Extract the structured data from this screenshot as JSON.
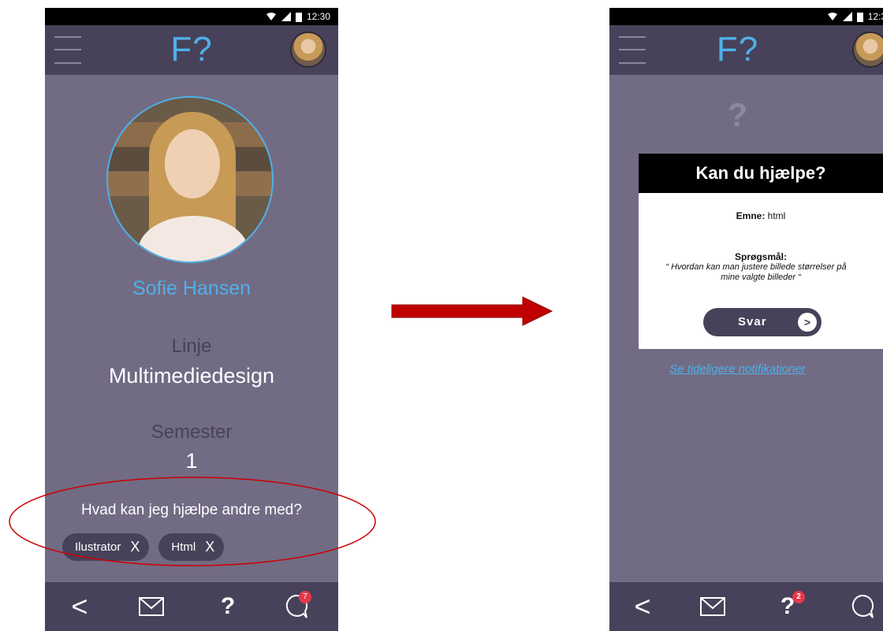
{
  "left_screen": {
    "status_time": "12:30",
    "logo": "F?",
    "profile": {
      "name": "Sofie Hansen",
      "line_label": "Linje",
      "line_value": "Multimediedesign",
      "semester_label": "Semester",
      "semester_value": "1"
    },
    "help_question": "Hvad kan jeg hjælpe andre med?",
    "tags": [
      {
        "label": "Ilustrator",
        "remove": "X"
      },
      {
        "label": "Html",
        "remove": "X"
      }
    ],
    "nav": {
      "back": "<",
      "help": "?",
      "chat_badge": "7"
    }
  },
  "right_screen": {
    "status_time": "12:3",
    "logo": "F?",
    "question_mark": "?",
    "card": {
      "title": "Kan du hjælpe?",
      "topic_label": "Emne:",
      "topic_value": "html",
      "question_label": "Sprøgsmål:",
      "question_text_1": "“ Hvordan kan man justere billede størrelser på",
      "question_text_2": "mine valgte billeder “",
      "answer_button": "Svar",
      "answer_icon": ">"
    },
    "see_previous": "Se tideligere notifikationer",
    "nav": {
      "back": "<",
      "help": "?",
      "help_badge": "2"
    }
  },
  "colors": {
    "background": "#726b84",
    "bars": "#474259",
    "accent": "#4fb0e8",
    "annotation": "#cc0000"
  }
}
